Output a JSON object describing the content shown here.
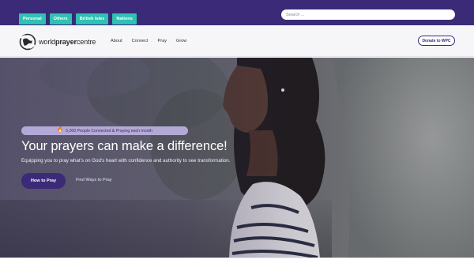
{
  "topbar": {
    "pills": [
      "Personal",
      "Others",
      "British Isles",
      "Nations"
    ],
    "search_placeholder": "Search ..."
  },
  "header": {
    "logo_light": "world",
    "logo_bold": "prayer",
    "logo_end": "centre",
    "nav": [
      "About",
      "Connect",
      "Pray",
      "Grow"
    ],
    "donate_label": "Donate to WPC"
  },
  "hero": {
    "badge": "5,000 People Connected & Praying each month",
    "badge_icon": "flame-icon",
    "headline": "Your prayers can make a difference!",
    "subline": "Equipping you to pray what's on God's heart with confidence and authority to see transformation.",
    "primary_button": "How to Pray",
    "secondary_link": "Find Ways to Pray"
  },
  "colors": {
    "brand_purple": "#3b2a78",
    "pill_teal": "#2fc1b2",
    "badge_lavender": "#beb2e2"
  }
}
